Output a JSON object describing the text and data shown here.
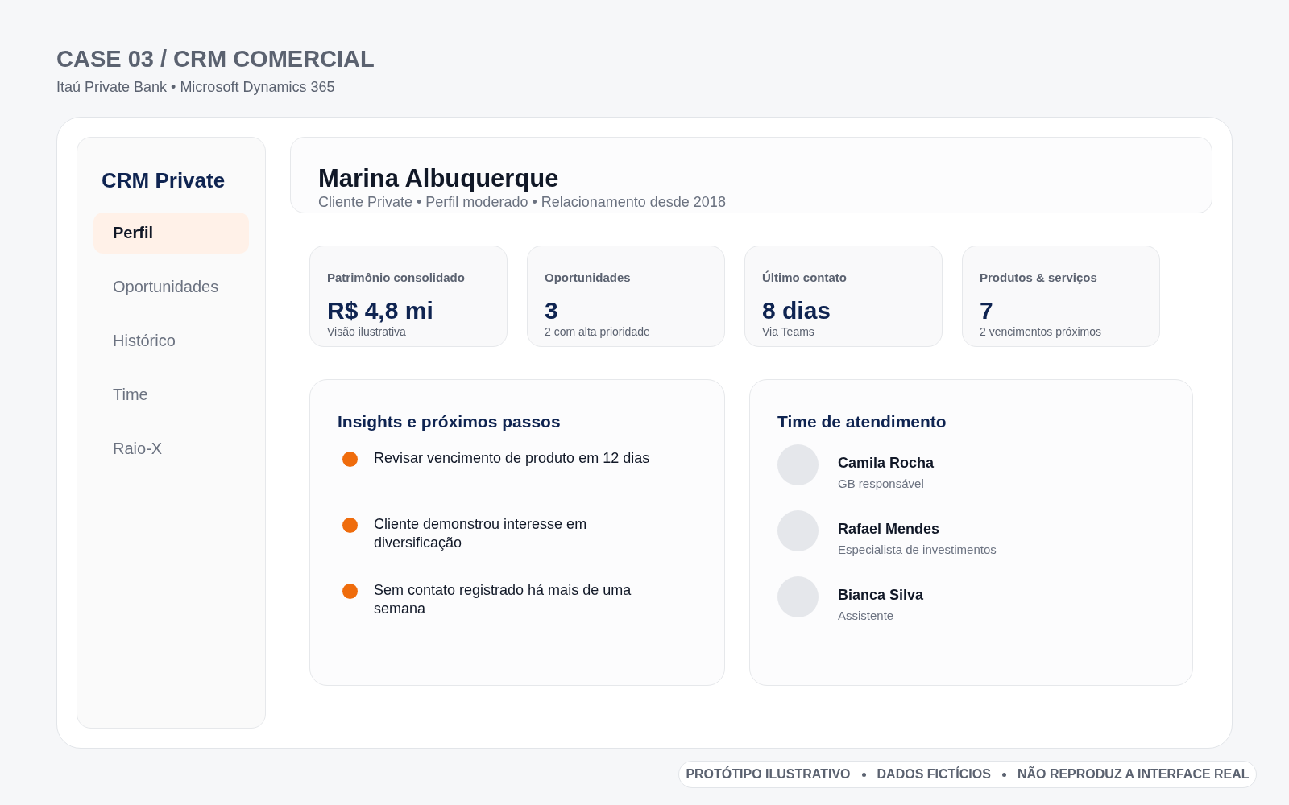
{
  "page": {
    "title": "CASE 03 / CRM COMERCIAL",
    "subtitle": "Itaú Private Bank • Microsoft Dynamics 365"
  },
  "sidebar": {
    "title": "CRM Private",
    "items": [
      {
        "label": "Perfil",
        "selected": true
      },
      {
        "label": "Oportunidades",
        "selected": false
      },
      {
        "label": "Histórico",
        "selected": false
      },
      {
        "label": "Time",
        "selected": false
      },
      {
        "label": "Raio-X",
        "selected": false
      }
    ]
  },
  "client": {
    "name": "Marina Albuquerque",
    "details": "Cliente Private • Perfil moderado • Relacionamento desde 2018"
  },
  "stats": [
    {
      "label": "Patrimônio consolidado",
      "value": "R$ 4,8 mi",
      "note": "Visão ilustrativa"
    },
    {
      "label": "Oportunidades",
      "value": "3",
      "note": "2 com alta prioridade"
    },
    {
      "label": "Último contato",
      "value": "8 dias",
      "note": "Via Teams"
    },
    {
      "label": "Produtos & serviços",
      "value": "7",
      "note": "2 vencimentos próximos"
    }
  ],
  "insights": {
    "title": "Insights e próximos passos",
    "items": [
      "Revisar vencimento de produto em 12 dias",
      "Cliente demonstrou interesse em diversificação",
      "Sem contato registrado há mais de uma semana"
    ]
  },
  "team": {
    "title": "Time de atendimento",
    "members": [
      {
        "name": "Camila Rocha",
        "role": "GB responsável"
      },
      {
        "name": "Rafael Mendes",
        "role": "Especialista de investimentos"
      },
      {
        "name": "Bianca Silva",
        "role": "Assistente"
      }
    ]
  },
  "footer": [
    "PROTÓTIPO ILUSTRATIVO",
    "DADOS FICTÍCIOS",
    "NÃO REPRODUZ A INTERFACE REAL"
  ]
}
